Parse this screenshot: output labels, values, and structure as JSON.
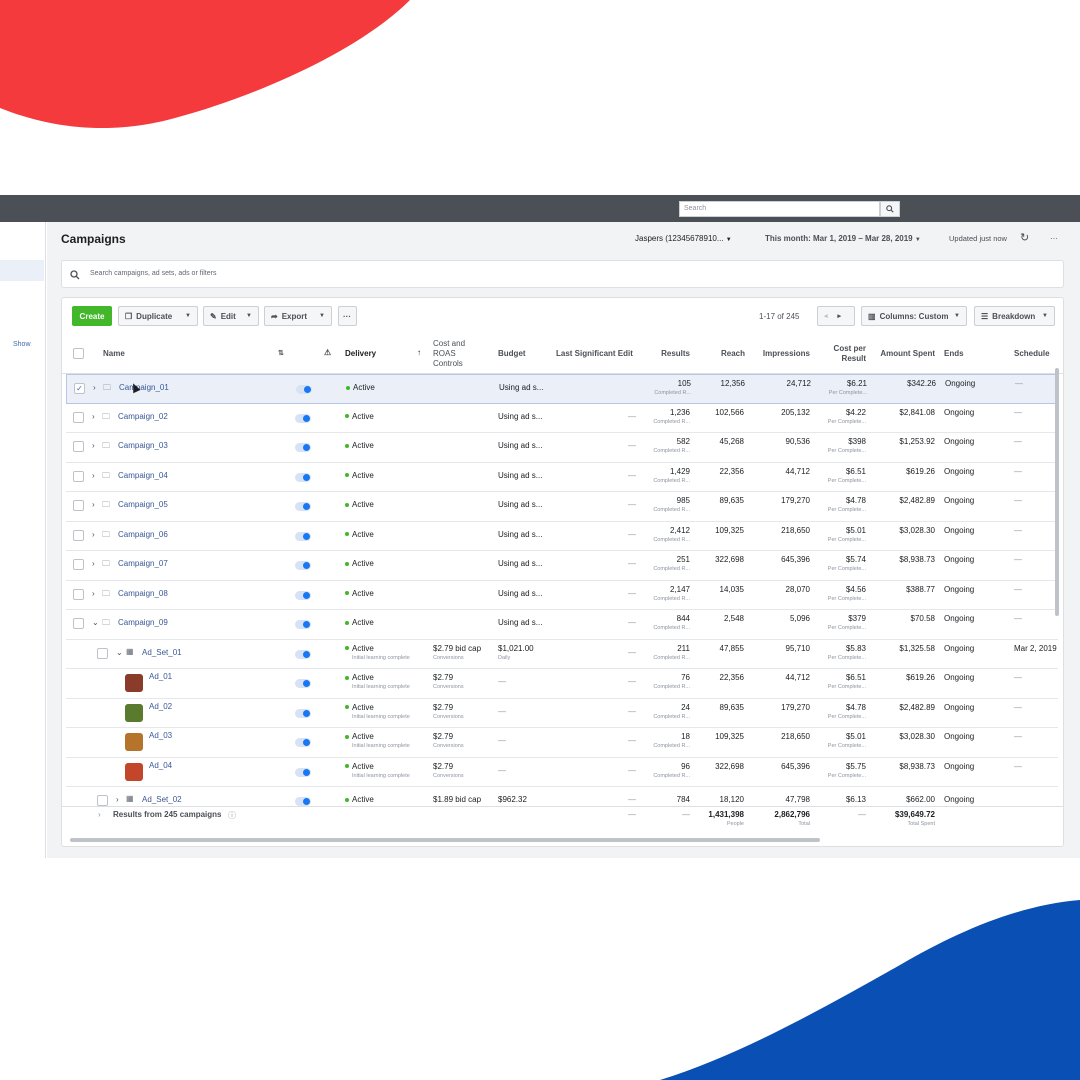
{
  "colors": {
    "top_blob": "#f43a3c",
    "bottom_blob": "#0a4fb4",
    "accent": "#4267b2",
    "create": "#42b72a"
  },
  "topbar": {
    "search_placeholder": "Search"
  },
  "sidebar": {
    "show_label": "Show"
  },
  "header": {
    "title": "Campaigns",
    "account": "Jaspers (12345678910...",
    "date_range": "This month: Mar 1, 2019 – Mar 28, 2019",
    "updated": "Updated just now",
    "more": "···"
  },
  "filter": {
    "placeholder": "Search campaigns, ad sets, ads or filters"
  },
  "toolbar": {
    "create": "Create",
    "duplicate": "Duplicate",
    "edit": "Edit",
    "export": "Export",
    "more": "···",
    "pagination": "1-17 of 245",
    "columns": "Columns: Custom",
    "breakdown": "Breakdown"
  },
  "columns": {
    "name": "Name",
    "delivery": "Delivery",
    "cost_roas_1": "Cost and",
    "cost_roas_2": "ROAS",
    "cost_roas_3": "Controls",
    "budget": "Budget",
    "last_edit": "Last Significant Edit",
    "results": "Results",
    "reach": "Reach",
    "impressions": "Impressions",
    "cpr_1": "Cost per",
    "cpr_2": "Result",
    "amount_spent": "Amount Spent",
    "ends": "Ends",
    "schedule": "Schedule"
  },
  "rows": [
    {
      "kind": "campaign",
      "name": "Campaign_01",
      "delivery": "Active",
      "delivery_sub": "",
      "cost": "",
      "cost_sub": "",
      "budget": "Using ad s...",
      "budget_sub": "",
      "edit": "",
      "results": "105",
      "results_sub": "Completed R...",
      "reach": "12,356",
      "impressions": "24,712",
      "cpr": "$6.21",
      "cpr_sub": "Per Complete...",
      "spent": "$342.26",
      "ends": "Ongoing",
      "schedule": "—",
      "expand": ">",
      "selected": true
    },
    {
      "kind": "campaign",
      "name": "Campaign_02",
      "delivery": "Active",
      "delivery_sub": "",
      "cost": "",
      "cost_sub": "",
      "budget": "Using ad s...",
      "budget_sub": "",
      "edit": "—",
      "results": "1,236",
      "results_sub": "Completed R...",
      "reach": "102,566",
      "impressions": "205,132",
      "cpr": "$4.22",
      "cpr_sub": "Per Complete...",
      "spent": "$2,841.08",
      "ends": "Ongoing",
      "schedule": "—",
      "expand": ">"
    },
    {
      "kind": "campaign",
      "name": "Campaign_03",
      "delivery": "Active",
      "delivery_sub": "",
      "cost": "",
      "cost_sub": "",
      "budget": "Using ad s...",
      "budget_sub": "",
      "edit": "—",
      "results": "582",
      "results_sub": "Completed R...",
      "reach": "45,268",
      "impressions": "90,536",
      "cpr": "$398",
      "cpr_sub": "Per Complete...",
      "spent": "$1,253.92",
      "ends": "Ongoing",
      "schedule": "—",
      "expand": ">"
    },
    {
      "kind": "campaign",
      "name": "Campaign_04",
      "delivery": "Active",
      "delivery_sub": "",
      "cost": "",
      "cost_sub": "",
      "budget": "Using ad s...",
      "budget_sub": "",
      "edit": "—",
      "results": "1,429",
      "results_sub": "Completed R...",
      "reach": "22,356",
      "impressions": "44,712",
      "cpr": "$6.51",
      "cpr_sub": "Per Complete...",
      "spent": "$619.26",
      "ends": "Ongoing",
      "schedule": "—",
      "expand": ">"
    },
    {
      "kind": "campaign",
      "name": "Campaign_05",
      "delivery": "Active",
      "delivery_sub": "",
      "cost": "",
      "cost_sub": "",
      "budget": "Using ad s...",
      "budget_sub": "",
      "edit": "—",
      "results": "985",
      "results_sub": "Completed R...",
      "reach": "89,635",
      "impressions": "179,270",
      "cpr": "$4.78",
      "cpr_sub": "Per Complete...",
      "spent": "$2,482.89",
      "ends": "Ongoing",
      "schedule": "—",
      "expand": ">"
    },
    {
      "kind": "campaign",
      "name": "Campaign_06",
      "delivery": "Active",
      "delivery_sub": "",
      "cost": "",
      "cost_sub": "",
      "budget": "Using ad s...",
      "budget_sub": "",
      "edit": "—",
      "results": "2,412",
      "results_sub": "Completed R...",
      "reach": "109,325",
      "impressions": "218,650",
      "cpr": "$5.01",
      "cpr_sub": "Per Complete...",
      "spent": "$3,028.30",
      "ends": "Ongoing",
      "schedule": "—",
      "expand": ">"
    },
    {
      "kind": "campaign",
      "name": "Campaign_07",
      "delivery": "Active",
      "delivery_sub": "",
      "cost": "",
      "cost_sub": "",
      "budget": "Using ad s...",
      "budget_sub": "",
      "edit": "—",
      "results": "251",
      "results_sub": "Completed R...",
      "reach": "322,698",
      "impressions": "645,396",
      "cpr": "$5.74",
      "cpr_sub": "Per Complete...",
      "spent": "$8,938.73",
      "ends": "Ongoing",
      "schedule": "—",
      "expand": ">"
    },
    {
      "kind": "campaign",
      "name": "Campaign_08",
      "delivery": "Active",
      "delivery_sub": "",
      "cost": "",
      "cost_sub": "",
      "budget": "Using ad s...",
      "budget_sub": "",
      "edit": "—",
      "results": "2,147",
      "results_sub": "Completed R...",
      "reach": "14,035",
      "impressions": "28,070",
      "cpr": "$4.56",
      "cpr_sub": "Per Complete...",
      "spent": "$388.77",
      "ends": "Ongoing",
      "schedule": "—",
      "expand": ">"
    },
    {
      "kind": "campaign",
      "name": "Campaign_09",
      "delivery": "Active",
      "delivery_sub": "",
      "cost": "",
      "cost_sub": "",
      "budget": "Using ad s...",
      "budget_sub": "",
      "edit": "—",
      "results": "844",
      "results_sub": "Completed R...",
      "reach": "2,548",
      "impressions": "5,096",
      "cpr": "$379",
      "cpr_sub": "Per Complete...",
      "spent": "$70.58",
      "ends": "Ongoing",
      "schedule": "—",
      "expand": "v"
    },
    {
      "kind": "adset",
      "name": "Ad_Set_01",
      "delivery": "Active",
      "delivery_sub": "Initial learning complete",
      "cost": "$2.79 bid cap",
      "cost_sub": "Conversions",
      "budget": "$1,021.00",
      "budget_sub": "Daily",
      "edit": "—",
      "results": "211",
      "results_sub": "Completed R...",
      "reach": "47,855",
      "impressions": "95,710",
      "cpr": "$5.83",
      "cpr_sub": "Per Complete...",
      "spent": "$1,325.58",
      "ends": "Ongoing",
      "schedule": "Mar 2, 2019",
      "expand": "v"
    },
    {
      "kind": "ad",
      "name": "Ad_01",
      "delivery": "Active",
      "delivery_sub": "Initial learning complete",
      "cost": "$2.79",
      "cost_sub": "Conversions",
      "budget": "—",
      "budget_sub": "",
      "edit": "—",
      "results": "76",
      "results_sub": "Completed R...",
      "reach": "22,356",
      "impressions": "44,712",
      "cpr": "$6.51",
      "cpr_sub": "Per Complete...",
      "spent": "$619.26",
      "ends": "Ongoing",
      "schedule": "—",
      "thumb": "#8a3b2a"
    },
    {
      "kind": "ad",
      "name": "Ad_02",
      "delivery": "Active",
      "delivery_sub": "Initial learning complete",
      "cost": "$2.79",
      "cost_sub": "Conversions",
      "budget": "—",
      "budget_sub": "",
      "edit": "—",
      "results": "24",
      "results_sub": "Completed R...",
      "reach": "89,635",
      "impressions": "179,270",
      "cpr": "$4.78",
      "cpr_sub": "Per Complete...",
      "spent": "$2,482.89",
      "ends": "Ongoing",
      "schedule": "—",
      "thumb": "#5a7a2e"
    },
    {
      "kind": "ad",
      "name": "Ad_03",
      "delivery": "Active",
      "delivery_sub": "Initial learning complete",
      "cost": "$2.79",
      "cost_sub": "Conversions",
      "budget": "—",
      "budget_sub": "",
      "edit": "—",
      "results": "18",
      "results_sub": "Completed R...",
      "reach": "109,325",
      "impressions": "218,650",
      "cpr": "$5.01",
      "cpr_sub": "Per Complete...",
      "spent": "$3,028.30",
      "ends": "Ongoing",
      "schedule": "—",
      "thumb": "#b5732c"
    },
    {
      "kind": "ad",
      "name": "Ad_04",
      "delivery": "Active",
      "delivery_sub": "Initial learning complete",
      "cost": "$2.79",
      "cost_sub": "Conversions",
      "budget": "—",
      "budget_sub": "",
      "edit": "—",
      "results": "96",
      "results_sub": "Completed R...",
      "reach": "322,698",
      "impressions": "645,396",
      "cpr": "$5.75",
      "cpr_sub": "Per Complete...",
      "spent": "$8,938.73",
      "ends": "Ongoing",
      "schedule": "—",
      "thumb": "#c4462a"
    },
    {
      "kind": "adset",
      "name": "Ad_Set_02",
      "delivery": "Active",
      "delivery_sub": "",
      "cost": "$1.89 bid cap",
      "cost_sub": "",
      "budget": "$962.32",
      "budget_sub": "",
      "edit": "—",
      "results": "784",
      "results_sub": "",
      "reach": "18,120",
      "impressions": "47,798",
      "cpr": "$6.13",
      "cpr_sub": "",
      "spent": "$662.00",
      "ends": "Ongoing",
      "schedule": "",
      "expand": ">"
    }
  ],
  "totals": {
    "label": "Results from 245 campaigns",
    "edit": "—",
    "results": "—",
    "reach": "1,431,398",
    "reach_sub": "People",
    "impressions": "2,862,796",
    "impressions_sub": "Total",
    "cpr": "—",
    "spent": "$39,649.72",
    "spent_sub": "Total Spent"
  }
}
